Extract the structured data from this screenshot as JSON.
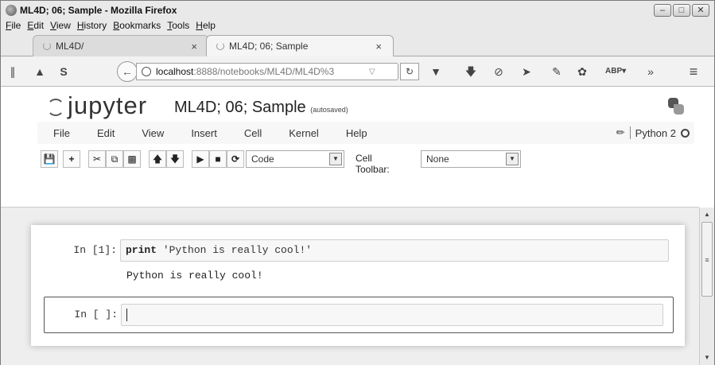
{
  "window": {
    "title": "ML4D; 06; Sample - Mozilla Firefox"
  },
  "menubar": [
    "File",
    "Edit",
    "View",
    "History",
    "Bookmarks",
    "Tools",
    "Help"
  ],
  "tabs": [
    {
      "label": "ML4D/",
      "active": false
    },
    {
      "label": "ML4D; 06; Sample",
      "active": true
    }
  ],
  "address": {
    "host": "localhost",
    "rest": ":8888/notebooks/ML4D/ML4D%3"
  },
  "jupyter": {
    "logo_text": "jupyter",
    "notebook_name": "ML4D; 06; Sample",
    "autosave": "(autosaved)",
    "menu": [
      "File",
      "Edit",
      "View",
      "Insert",
      "Cell",
      "Kernel",
      "Help"
    ],
    "kernel_name": "Python 2",
    "cell_type": "Code",
    "cell_toolbar_label": "Cell Toolbar:",
    "cell_toolbar_value": "None"
  },
  "cells": [
    {
      "prompt": "In [1]:",
      "keyword": "print",
      "code_rest": " 'Python is really cool!'",
      "output": "Python is really cool!"
    },
    {
      "prompt": "In [ ]:",
      "code": ""
    }
  ],
  "colors": {
    "page_bg": "#eeeeee",
    "chrome_bg": "#e9e9e9"
  }
}
